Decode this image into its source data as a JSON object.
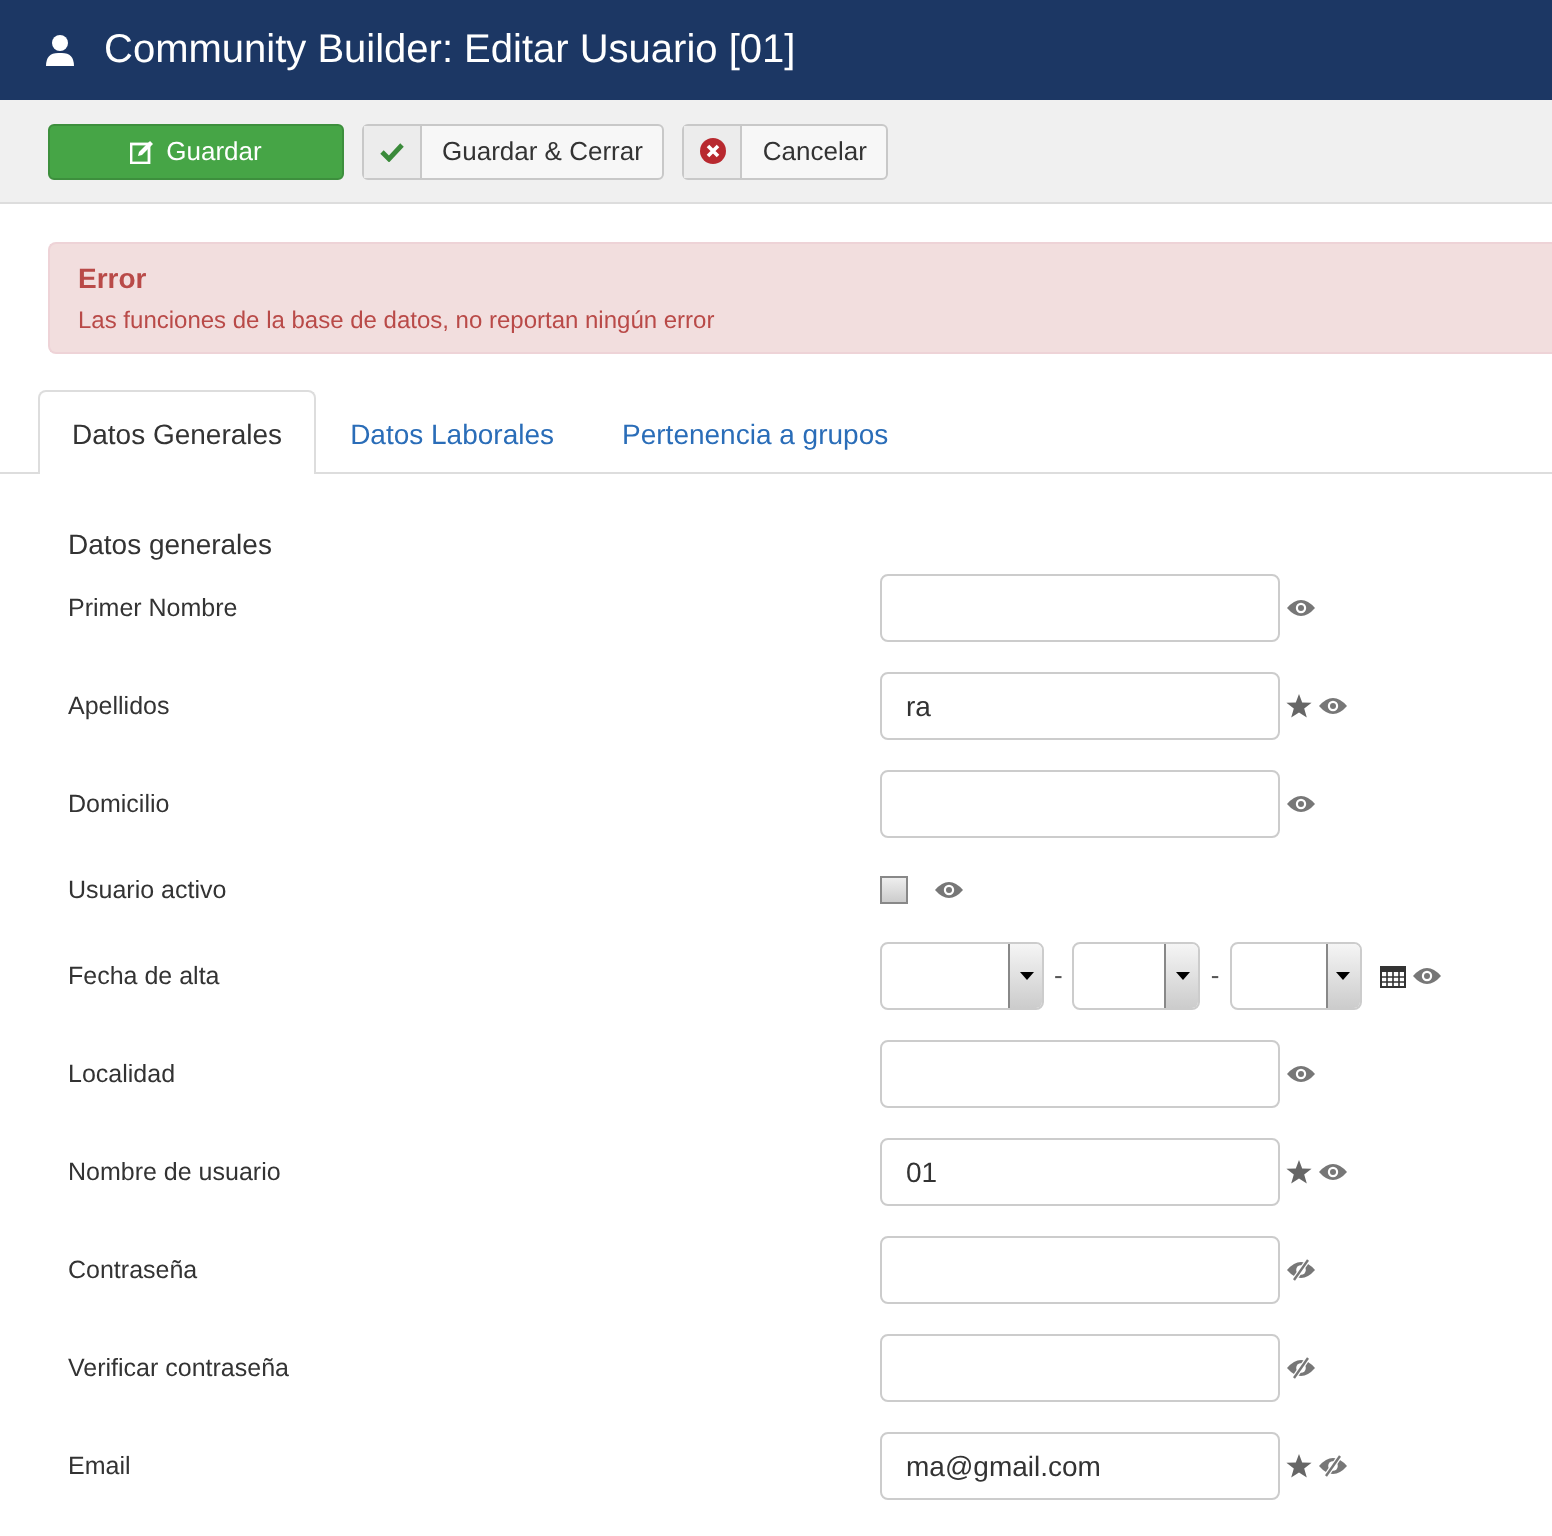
{
  "header": {
    "title": "Community Builder: Editar Usuario [01]"
  },
  "toolbar": [
    {
      "label": "Guardar",
      "kind": "primary"
    },
    {
      "label": "Guardar & Cerrar",
      "kind": "check"
    },
    {
      "label": "Cancelar",
      "kind": "cancel"
    }
  ],
  "alert": {
    "title": "Error",
    "message": "Las funciones de la base de datos, no reportan ningún error"
  },
  "tabs": [
    {
      "label": "Datos Generales",
      "selected": true
    },
    {
      "label": "Datos Laborales",
      "selected": false
    },
    {
      "label": "Pertenencia a grupos",
      "selected": false
    }
  ],
  "section_title": "Datos generales",
  "fields": [
    {
      "label": "Primer Nombre",
      "kind": "text",
      "required": false,
      "visible": true
    },
    {
      "label": "Apellidos",
      "kind": "text",
      "value": "ra",
      "required": true,
      "visible": true
    },
    {
      "label": "Domicilio",
      "kind": "text",
      "required": false,
      "visible": true
    },
    {
      "label": "Usuario activo",
      "kind": "checkbox",
      "checked": false,
      "required": false,
      "visible": true
    },
    {
      "label": "Fecha de alta",
      "kind": "date",
      "separators": [
        "-",
        "-"
      ],
      "required": false,
      "visible": true
    },
    {
      "label": "Localidad",
      "kind": "text",
      "required": false,
      "visible": true
    },
    {
      "label": "Nombre de usuario",
      "kind": "text",
      "value": "01",
      "required": true,
      "visible": true
    },
    {
      "label": "Contraseña",
      "kind": "text",
      "required": false,
      "visible": false
    },
    {
      "label": "Verificar contraseña",
      "kind": "text",
      "required": false,
      "visible": false
    },
    {
      "label": "Email",
      "kind": "text",
      "value": "ma@gmail.com",
      "required": true,
      "visible": false
    }
  ]
}
